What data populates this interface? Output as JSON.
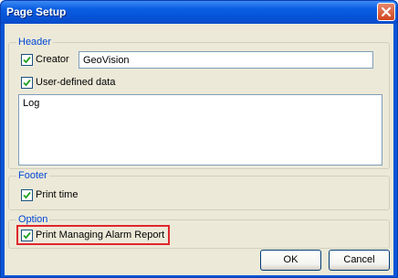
{
  "window": {
    "title": "Page Setup"
  },
  "header_group": {
    "label": "Header",
    "creator": {
      "label": "Creator",
      "checked": true,
      "value": "GeoVision"
    },
    "user_defined": {
      "label": "User-defined data",
      "checked": true,
      "value": "Log"
    }
  },
  "footer_group": {
    "label": "Footer",
    "print_time": {
      "label": "Print time",
      "checked": true
    }
  },
  "option_group": {
    "label": "Option",
    "print_report": {
      "label": "Print Managing Alarm Report",
      "checked": true
    }
  },
  "buttons": {
    "ok": "OK",
    "cancel": "Cancel"
  }
}
